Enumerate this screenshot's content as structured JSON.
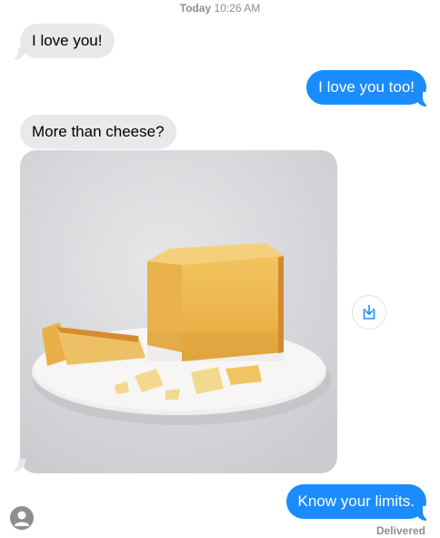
{
  "header": {
    "day": "Today",
    "time": "10:26 AM"
  },
  "messages": [
    {
      "side": "received",
      "text": "I love you!"
    },
    {
      "side": "sent",
      "text": "I love you too!"
    },
    {
      "side": "received",
      "text": "More than cheese?"
    },
    {
      "side": "received",
      "type": "image",
      "icon": "cheese-photo"
    },
    {
      "side": "sent",
      "text": "Know your limits."
    }
  ],
  "status": {
    "delivered": "Delivered"
  },
  "icons": {
    "save": "save-download-icon",
    "avatar": "person-icon"
  },
  "colors": {
    "sent_bubble": "#1a8cff",
    "received_bubble": "#e9e9eb",
    "meta_text": "#8e8e93"
  }
}
